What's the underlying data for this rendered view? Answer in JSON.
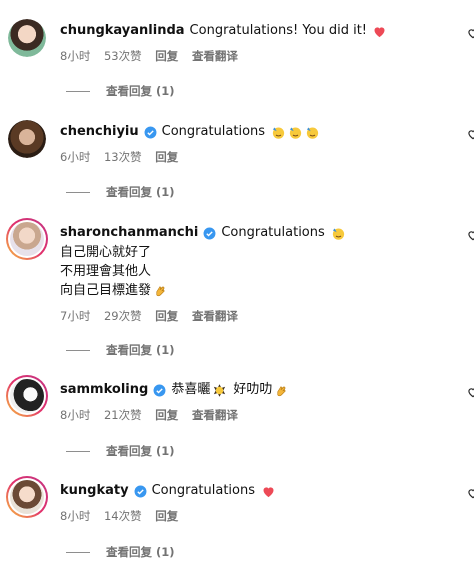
{
  "comments": [
    {
      "username": "chungkayanlinda",
      "verified": false,
      "text": "Congratulations! You did it!",
      "time": "8小时",
      "likes": "53次赞",
      "reply_label": "回复",
      "translate_label": "查看翻译",
      "view_replies": "查看回复 (1)"
    },
    {
      "username": "chenchiyiu",
      "verified": true,
      "text": "Congratulations",
      "time": "6小时",
      "likes": "13次赞",
      "reply_label": "回复",
      "view_replies": "查看回复 (1)"
    },
    {
      "username": "sharonchanmanchi",
      "verified": true,
      "text": "Congratulations",
      "extra_lines": [
        "自己開心就好了",
        "不用理會其他人",
        "向自己目標進發"
      ],
      "time": "7小时",
      "likes": "29次赞",
      "reply_label": "回复",
      "translate_label": "查看翻译",
      "view_replies": "查看回复 (1)"
    },
    {
      "username": "sammkoling",
      "verified": true,
      "text": "恭喜曬",
      "text2": "好叻叻",
      "time": "8小时",
      "likes": "21次赞",
      "reply_label": "回复",
      "translate_label": "查看翻译",
      "view_replies": "查看回复 (1)"
    },
    {
      "username": "kungkaty",
      "verified": true,
      "text": "Congratulations",
      "time": "8小时",
      "likes": "14次赞",
      "reply_label": "回复",
      "view_replies": "查看回复 (1)"
    }
  ],
  "colors": {
    "verified": "#3897f0",
    "heart": "#ed4956",
    "meta": "#737373"
  },
  "icons": [
    "heart-icon",
    "verified-badge-icon",
    "celebrate-face-icon",
    "clap-icon",
    "like-outline-icon"
  ]
}
